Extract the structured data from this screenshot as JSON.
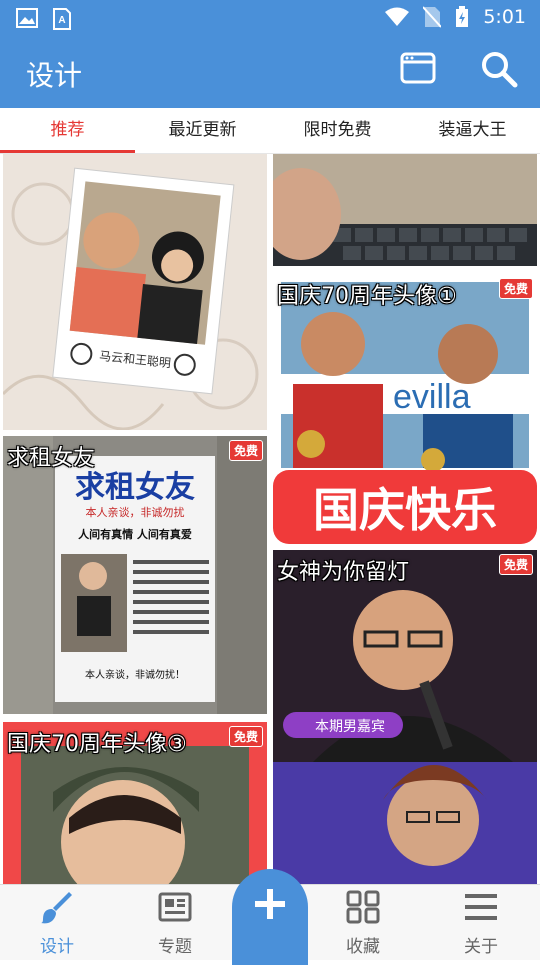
{
  "status_bar": {
    "time": "5:01"
  },
  "app_bar": {
    "title": "设计"
  },
  "tabs": [
    {
      "label": "推荐",
      "active": true
    },
    {
      "label": "最近更新",
      "active": false
    },
    {
      "label": "限时免费",
      "active": false
    },
    {
      "label": "装逼大王",
      "active": false
    }
  ],
  "cards": {
    "c1": {
      "caption": "马云和王聪明"
    },
    "c3": {
      "label": "国庆70周年头像①",
      "badge": "免费",
      "banner": "国庆快乐",
      "sign": "evilla"
    },
    "c4": {
      "label": "求租女友",
      "badge": "免费",
      "poster_title": "求租女友",
      "poster_sub": "本人亲谈，非诚勿扰",
      "poster_line": "人间有真情  人间有真爱",
      "poster_footer": "本人亲谈，非诚勿扰！"
    },
    "c5": {
      "label": "女神为你留灯",
      "badge": "免费",
      "ribbon": "本期男嘉宾"
    },
    "c6": {
      "label": "国庆70周年头像③",
      "badge": "免费"
    }
  },
  "bottom_nav": [
    {
      "label": "设计",
      "icon": "brush-icon",
      "active": true
    },
    {
      "label": "专题",
      "icon": "newspaper-icon",
      "active": false
    },
    {
      "label": "收藏",
      "icon": "grid-icon",
      "active": false
    },
    {
      "label": "关于",
      "icon": "menu-icon",
      "active": false
    }
  ],
  "colors": {
    "primary": "#4a90d9",
    "accent": "#e53935"
  }
}
